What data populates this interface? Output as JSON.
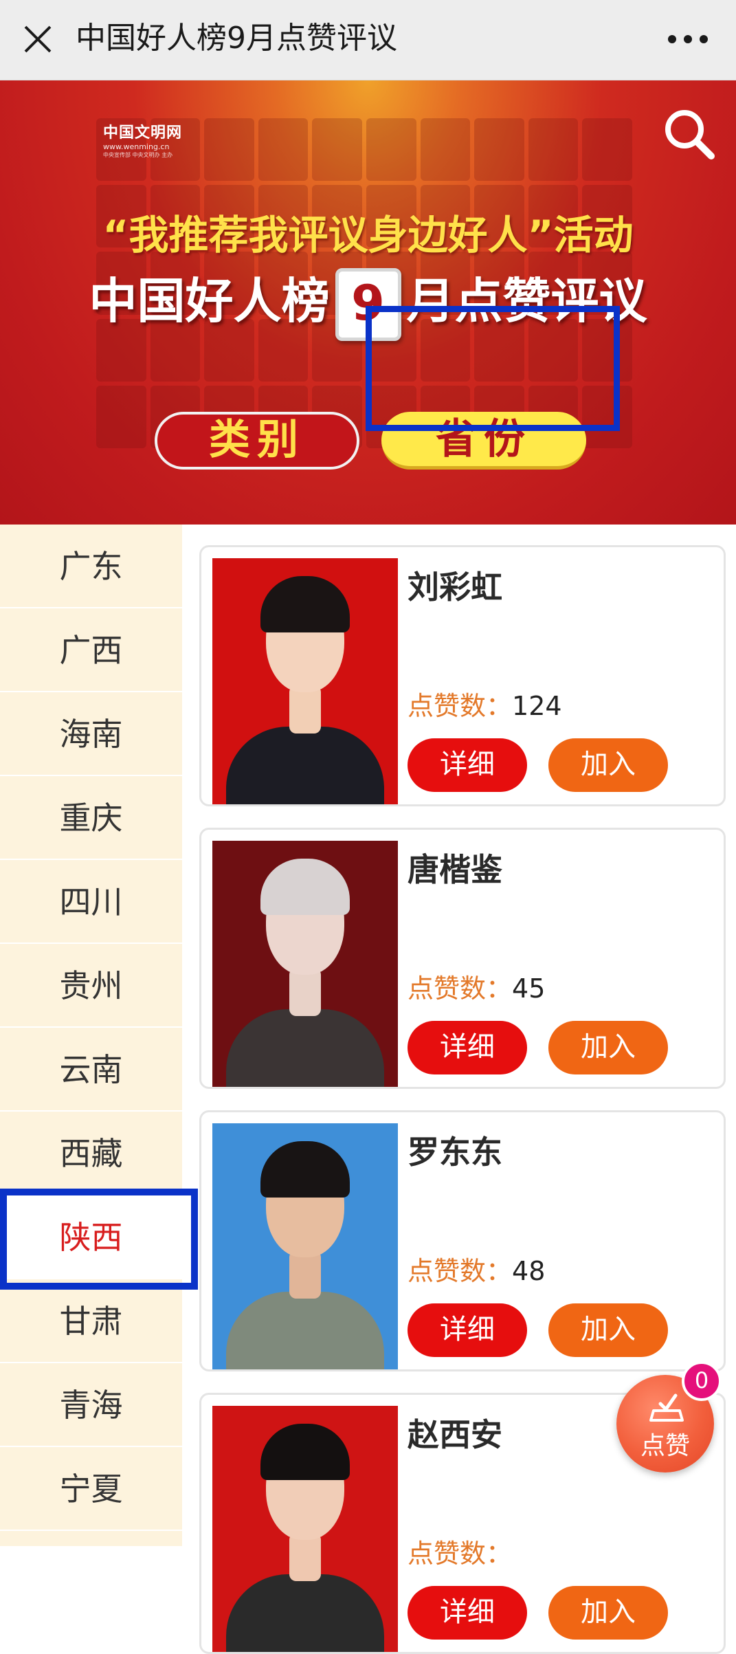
{
  "header": {
    "title": "中国好人榜9月点赞评议"
  },
  "banner": {
    "logo_text": "中国文明网",
    "logo_url": "www.wenming.cn",
    "logo_small": "中央宣传部 中央文明办 主办",
    "slogan": "“我推荐我评议身边好人”活动",
    "headline_before": "中国好人榜",
    "headline_month": "9",
    "headline_after": "月点赞评议",
    "tab_category": "类别",
    "tab_province": "省份",
    "selected_tab": "省份"
  },
  "sidebar": {
    "items": [
      {
        "label": "广东"
      },
      {
        "label": "广西"
      },
      {
        "label": "海南"
      },
      {
        "label": "重庆"
      },
      {
        "label": "四川"
      },
      {
        "label": "贵州"
      },
      {
        "label": "云南"
      },
      {
        "label": "西藏"
      },
      {
        "label": "陕西"
      },
      {
        "label": "甘肃"
      },
      {
        "label": "青海"
      },
      {
        "label": "宁夏"
      }
    ],
    "selected": "陕西"
  },
  "cards": [
    {
      "name": "刘彩虹",
      "likes_label": "点赞数：",
      "likes": "124",
      "detail": "详细",
      "join": "加入"
    },
    {
      "name": "唐楷鉴",
      "likes_label": "点赞数：",
      "likes": "45",
      "detail": "详细",
      "join": "加入"
    },
    {
      "name": "罗东东",
      "likes_label": "点赞数：",
      "likes": "48",
      "detail": "详细",
      "join": "加入"
    },
    {
      "name": "赵西安",
      "likes_label": "点赞数：",
      "likes": "",
      "detail": "详细",
      "join": "加入"
    }
  ],
  "fab": {
    "label": "点赞",
    "badge": "0"
  },
  "colors": {
    "highlight_box": "#0a32c8",
    "detail_button": "#e60e0e",
    "join_button": "#f06614",
    "likes_label": "#e3792a",
    "selected_sidebar_text": "#d81e1e"
  }
}
